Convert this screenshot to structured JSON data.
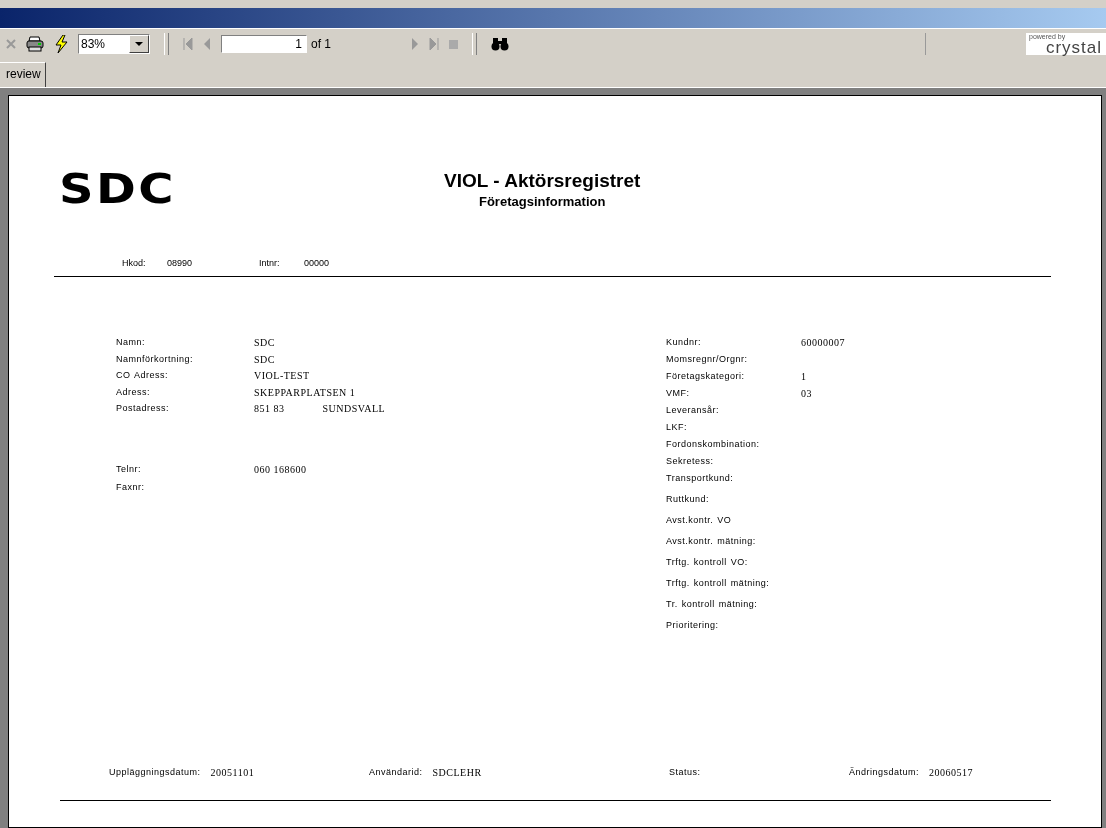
{
  "toolbar": {
    "zoom": "83%",
    "page": "1",
    "page_of": "of 1",
    "brand_small": "powered by",
    "brand": "crystal"
  },
  "tabs": [
    {
      "label": "review",
      "selected": true
    }
  ],
  "report": {
    "logo": "SDC",
    "title": "VIOL - Aktörsregistret",
    "subtitle": "Företagsinformation",
    "header_fields": [
      {
        "label": "Hkod:",
        "value": "08990"
      },
      {
        "label": "Intnr:",
        "value": "00000"
      }
    ],
    "left_fields": [
      {
        "label": "Namn:",
        "value": "SDC"
      },
      {
        "label": "Namnförkortning:",
        "value": "SDC"
      },
      {
        "label": "CO Adress:",
        "value": "VIOL-TEST"
      },
      {
        "label": "Adress:",
        "value": "SKEPPARPLATSEN 1"
      },
      {
        "label": "Postadress:",
        "value": "851 83",
        "extra": "SUNDSVALL"
      }
    ],
    "contact_fields": [
      {
        "label": "Telnr:",
        "value": "060 168600"
      },
      {
        "label": "Faxnr:"
      }
    ],
    "right_fields": [
      {
        "label": "Kundnr:",
        "value": "60000007"
      },
      {
        "label": "Momsregnr/Orgnr:"
      },
      {
        "label": "Företagskategori:",
        "value": "1"
      },
      {
        "label": "VMF:",
        "value": "03"
      },
      {
        "label": "Leveransår:"
      },
      {
        "label": "LKF:"
      },
      {
        "label": "Fordonskombination:"
      },
      {
        "label": "Sekretess:"
      },
      {
        "label": "Transportkund:"
      },
      {
        "label": "Ruttkund:"
      },
      {
        "label": "Avst.kontr. VO"
      },
      {
        "label": "Avst.kontr. mätning:"
      },
      {
        "label": "Trftg. kontroll VO:"
      },
      {
        "label": "Trftg. kontroll mätning:"
      },
      {
        "label": "Tr. kontroll mätning:"
      },
      {
        "label": "Prioritering:"
      }
    ],
    "footer_fields": [
      {
        "label": "Uppläggningsdatum:",
        "value": "20051101"
      },
      {
        "label": "Användarid:",
        "value": "SDCLEHR"
      },
      {
        "label": "Status:"
      },
      {
        "label": "Ändringsdatum:",
        "value": "20060517"
      }
    ]
  }
}
